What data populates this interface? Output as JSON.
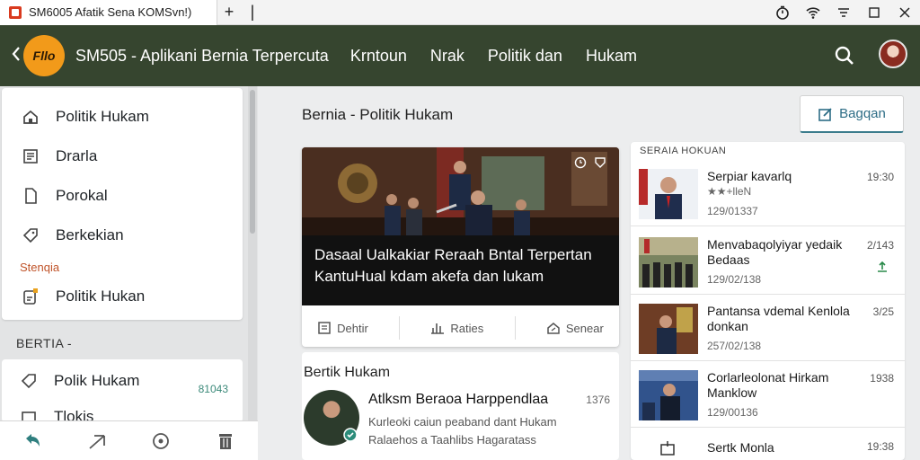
{
  "browser": {
    "tab_title": "SM6005 Afatik Sena KOMSvn!)",
    "new_tab": "+",
    "tab_extra": "|"
  },
  "app": {
    "title": "SM505 - Aplikani Bernia Terpercuta",
    "nav": [
      "Krntoun",
      "Nrak",
      "Politik dan",
      "Hukam"
    ],
    "logo_text": "Fllo"
  },
  "sidebar": {
    "items": [
      {
        "label": "Politik Hukam",
        "icon": "home-icon"
      },
      {
        "label": "Drarla",
        "icon": "list-icon"
      },
      {
        "label": "Porokal",
        "icon": "document-icon"
      },
      {
        "label": "Berkekian",
        "icon": "tag-icon"
      }
    ],
    "sub_label": "Stenqia",
    "sub_item": {
      "label": "Politik Hukan",
      "icon": "edit-note-icon"
    },
    "section_label": "BERTIA -",
    "section_items": [
      {
        "label": "Polik Hukam",
        "badge": "81043",
        "icon": "tag-icon"
      },
      {
        "label": "Tlokis",
        "icon": "box-icon"
      }
    ]
  },
  "main": {
    "heading": "Bernia - Politik Hukam",
    "share_label": "Bagqan",
    "featured": {
      "caption": "Dasaal Ualkakiar Reraah Bntal Terpertan KantuHual kdam akefa dan lukam",
      "actions": [
        "Dehtir",
        "Raties",
        "Senear"
      ]
    },
    "section2": {
      "title": "Bertik Hukam",
      "article": {
        "title": "Atlksm Beraoa Harppendlaa",
        "time": "1376",
        "line1": "Kurleoki caiun peaband dant Hukam",
        "line2": "Ralaehos a Taahlibs Hagaratass"
      }
    }
  },
  "side_list": {
    "label": "SERAIA HOKUAN",
    "items": [
      {
        "title": "Serpiar kavarlq",
        "sub": "★★+lleN",
        "date": "129/01337",
        "time": "19:30"
      },
      {
        "title": "Menvabaqolyiyar yedaik Bedaas",
        "date": "129/02/138",
        "time": "2/143"
      },
      {
        "title": "Pantansa vdemal Kenlola donkan",
        "date": "257/02/138",
        "time": "3/25"
      },
      {
        "title": "Corlarleolonat Hirkam Manklow",
        "date": "129/00136",
        "time": "1938"
      },
      {
        "title": "Sertk Monla",
        "time": "19:38"
      }
    ]
  }
}
